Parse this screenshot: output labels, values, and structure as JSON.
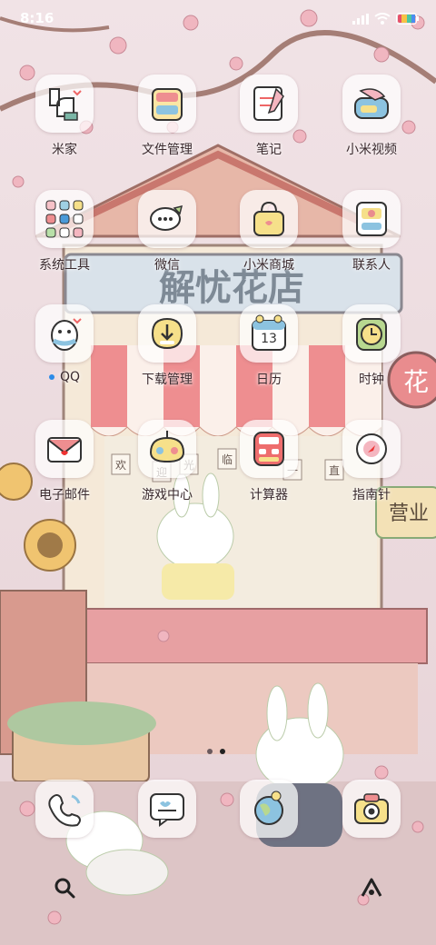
{
  "status_bar": {
    "time": "8:16",
    "icons": [
      "signal-icon",
      "wifi-icon",
      "battery-icon"
    ]
  },
  "wallpaper": {
    "shop_sign": "解忧花店",
    "flower_badge": "花",
    "open_sign": "营业",
    "banner_chars": [
      "欢",
      "迎",
      "光",
      "临",
      "一",
      "直"
    ]
  },
  "apps": [
    {
      "name": "米家",
      "icon": "mijia-icon"
    },
    {
      "name": "文件管理",
      "icon": "file-manager-icon"
    },
    {
      "name": "笔记",
      "icon": "notes-icon"
    },
    {
      "name": "小米视频",
      "icon": "video-icon"
    },
    {
      "name": "系统工具",
      "icon": "system-tools-folder-icon"
    },
    {
      "name": "微信",
      "icon": "wechat-icon"
    },
    {
      "name": "小米商城",
      "icon": "mi-store-icon"
    },
    {
      "name": "联系人",
      "icon": "contacts-icon"
    },
    {
      "name": "QQ",
      "icon": "qq-icon",
      "badge_dot": true
    },
    {
      "name": "下载管理",
      "icon": "download-icon"
    },
    {
      "name": "日历",
      "icon": "calendar-icon",
      "calendar_day": "13"
    },
    {
      "name": "时钟",
      "icon": "clock-icon"
    },
    {
      "name": "电子邮件",
      "icon": "email-icon"
    },
    {
      "name": "游戏中心",
      "icon": "game-center-icon"
    },
    {
      "name": "计算器",
      "icon": "calculator-icon"
    },
    {
      "name": "指南针",
      "icon": "compass-icon"
    }
  ],
  "dock": [
    {
      "icon": "phone-icon"
    },
    {
      "icon": "messages-icon"
    },
    {
      "icon": "browser-icon"
    },
    {
      "icon": "camera-icon"
    }
  ],
  "page_indicator": {
    "pages": 2,
    "current": 2
  },
  "nav": {
    "left_icon": "search-icon",
    "right_icon": "assistant-icon"
  },
  "colors": {
    "pink": "#f2a7b5",
    "cream": "#fbf3e6",
    "accent_red": "#e3535c",
    "text": "#3a2a2e"
  }
}
